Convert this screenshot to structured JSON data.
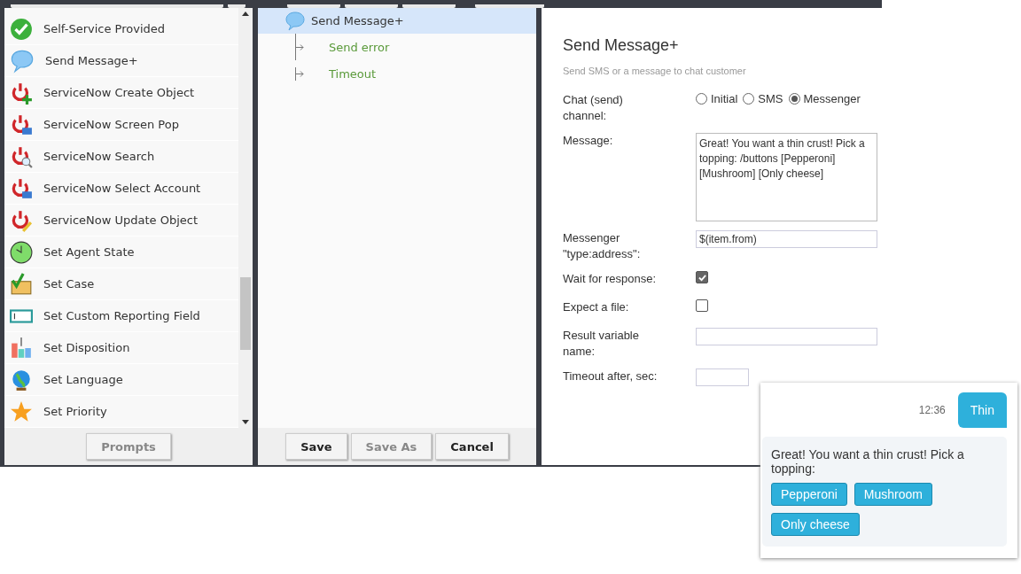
{
  "palette": {
    "items": [
      {
        "label": "Self-Service Provided"
      },
      {
        "label": "Send Message+"
      },
      {
        "label": "ServiceNow Create Object"
      },
      {
        "label": "ServiceNow Screen Pop"
      },
      {
        "label": "ServiceNow Search"
      },
      {
        "label": "ServiceNow Select Account"
      },
      {
        "label": "ServiceNow Update Object"
      },
      {
        "label": "Set Agent State"
      },
      {
        "label": "Set Case"
      },
      {
        "label": "Set Custom Reporting Field"
      },
      {
        "label": "Set Disposition"
      },
      {
        "label": "Set Language"
      },
      {
        "label": "Set Priority"
      }
    ],
    "button": {
      "label": "Prompts",
      "disabled": true
    }
  },
  "tree": {
    "root": {
      "label": "Send Message+",
      "selected": true,
      "children": [
        {
          "label": "Send error"
        },
        {
          "label": "Timeout"
        }
      ]
    },
    "buttons": [
      {
        "label": "Save",
        "disabled": false
      },
      {
        "label": "Save As",
        "disabled": true
      },
      {
        "label": "Cancel",
        "disabled": false
      }
    ]
  },
  "properties": {
    "title": "Send Message+",
    "subtitle": "Send SMS or a message to chat customer",
    "fields": [
      {
        "kind": "radio",
        "label": "Chat (send) channel:",
        "options": [
          {
            "label": "Initial",
            "selected": false
          },
          {
            "label": "SMS",
            "selected": false
          },
          {
            "label": "Messenger",
            "selected": true
          }
        ]
      },
      {
        "kind": "textarea",
        "label": "Message:",
        "value": "Great! You want a thin crust! Pick a topping: /buttons [Pepperoni] [Mushroom] [Only cheese]"
      },
      {
        "kind": "text",
        "label": "Messenger \"type:address\":",
        "value": "$(item.from)"
      },
      {
        "kind": "checkbox",
        "label": "Wait for response:",
        "checked": true
      },
      {
        "kind": "checkbox",
        "label": "Expect a file:",
        "checked": false
      },
      {
        "kind": "text",
        "label": "Result variable name:"
      },
      {
        "kind": "short",
        "label": "Timeout after, sec:"
      }
    ]
  },
  "chat": {
    "time": "12:36",
    "user_message": "Thin",
    "bot_message": "Great! You want a thin crust! Pick a topping:",
    "buttons": [
      "Pepperoni",
      "Mushroom",
      "Only cheese"
    ]
  }
}
